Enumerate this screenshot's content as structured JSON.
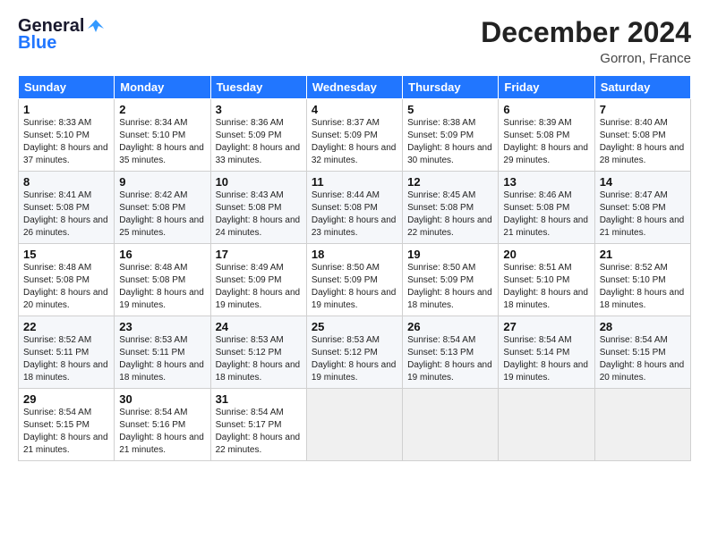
{
  "logo": {
    "general": "General",
    "blue": "Blue"
  },
  "header": {
    "month_year": "December 2024",
    "location": "Gorron, France"
  },
  "columns": [
    "Sunday",
    "Monday",
    "Tuesday",
    "Wednesday",
    "Thursday",
    "Friday",
    "Saturday"
  ],
  "weeks": [
    [
      {
        "day": "1",
        "sunrise": "Sunrise: 8:33 AM",
        "sunset": "Sunset: 5:10 PM",
        "daylight": "Daylight: 8 hours and 37 minutes."
      },
      {
        "day": "2",
        "sunrise": "Sunrise: 8:34 AM",
        "sunset": "Sunset: 5:10 PM",
        "daylight": "Daylight: 8 hours and 35 minutes."
      },
      {
        "day": "3",
        "sunrise": "Sunrise: 8:36 AM",
        "sunset": "Sunset: 5:09 PM",
        "daylight": "Daylight: 8 hours and 33 minutes."
      },
      {
        "day": "4",
        "sunrise": "Sunrise: 8:37 AM",
        "sunset": "Sunset: 5:09 PM",
        "daylight": "Daylight: 8 hours and 32 minutes."
      },
      {
        "day": "5",
        "sunrise": "Sunrise: 8:38 AM",
        "sunset": "Sunset: 5:09 PM",
        "daylight": "Daylight: 8 hours and 30 minutes."
      },
      {
        "day": "6",
        "sunrise": "Sunrise: 8:39 AM",
        "sunset": "Sunset: 5:08 PM",
        "daylight": "Daylight: 8 hours and 29 minutes."
      },
      {
        "day": "7",
        "sunrise": "Sunrise: 8:40 AM",
        "sunset": "Sunset: 5:08 PM",
        "daylight": "Daylight: 8 hours and 28 minutes."
      }
    ],
    [
      {
        "day": "8",
        "sunrise": "Sunrise: 8:41 AM",
        "sunset": "Sunset: 5:08 PM",
        "daylight": "Daylight: 8 hours and 26 minutes."
      },
      {
        "day": "9",
        "sunrise": "Sunrise: 8:42 AM",
        "sunset": "Sunset: 5:08 PM",
        "daylight": "Daylight: 8 hours and 25 minutes."
      },
      {
        "day": "10",
        "sunrise": "Sunrise: 8:43 AM",
        "sunset": "Sunset: 5:08 PM",
        "daylight": "Daylight: 8 hours and 24 minutes."
      },
      {
        "day": "11",
        "sunrise": "Sunrise: 8:44 AM",
        "sunset": "Sunset: 5:08 PM",
        "daylight": "Daylight: 8 hours and 23 minutes."
      },
      {
        "day": "12",
        "sunrise": "Sunrise: 8:45 AM",
        "sunset": "Sunset: 5:08 PM",
        "daylight": "Daylight: 8 hours and 22 minutes."
      },
      {
        "day": "13",
        "sunrise": "Sunrise: 8:46 AM",
        "sunset": "Sunset: 5:08 PM",
        "daylight": "Daylight: 8 hours and 21 minutes."
      },
      {
        "day": "14",
        "sunrise": "Sunrise: 8:47 AM",
        "sunset": "Sunset: 5:08 PM",
        "daylight": "Daylight: 8 hours and 21 minutes."
      }
    ],
    [
      {
        "day": "15",
        "sunrise": "Sunrise: 8:48 AM",
        "sunset": "Sunset: 5:08 PM",
        "daylight": "Daylight: 8 hours and 20 minutes."
      },
      {
        "day": "16",
        "sunrise": "Sunrise: 8:48 AM",
        "sunset": "Sunset: 5:08 PM",
        "daylight": "Daylight: 8 hours and 19 minutes."
      },
      {
        "day": "17",
        "sunrise": "Sunrise: 8:49 AM",
        "sunset": "Sunset: 5:09 PM",
        "daylight": "Daylight: 8 hours and 19 minutes."
      },
      {
        "day": "18",
        "sunrise": "Sunrise: 8:50 AM",
        "sunset": "Sunset: 5:09 PM",
        "daylight": "Daylight: 8 hours and 19 minutes."
      },
      {
        "day": "19",
        "sunrise": "Sunrise: 8:50 AM",
        "sunset": "Sunset: 5:09 PM",
        "daylight": "Daylight: 8 hours and 18 minutes."
      },
      {
        "day": "20",
        "sunrise": "Sunrise: 8:51 AM",
        "sunset": "Sunset: 5:10 PM",
        "daylight": "Daylight: 8 hours and 18 minutes."
      },
      {
        "day": "21",
        "sunrise": "Sunrise: 8:52 AM",
        "sunset": "Sunset: 5:10 PM",
        "daylight": "Daylight: 8 hours and 18 minutes."
      }
    ],
    [
      {
        "day": "22",
        "sunrise": "Sunrise: 8:52 AM",
        "sunset": "Sunset: 5:11 PM",
        "daylight": "Daylight: 8 hours and 18 minutes."
      },
      {
        "day": "23",
        "sunrise": "Sunrise: 8:53 AM",
        "sunset": "Sunset: 5:11 PM",
        "daylight": "Daylight: 8 hours and 18 minutes."
      },
      {
        "day": "24",
        "sunrise": "Sunrise: 8:53 AM",
        "sunset": "Sunset: 5:12 PM",
        "daylight": "Daylight: 8 hours and 18 minutes."
      },
      {
        "day": "25",
        "sunrise": "Sunrise: 8:53 AM",
        "sunset": "Sunset: 5:12 PM",
        "daylight": "Daylight: 8 hours and 19 minutes."
      },
      {
        "day": "26",
        "sunrise": "Sunrise: 8:54 AM",
        "sunset": "Sunset: 5:13 PM",
        "daylight": "Daylight: 8 hours and 19 minutes."
      },
      {
        "day": "27",
        "sunrise": "Sunrise: 8:54 AM",
        "sunset": "Sunset: 5:14 PM",
        "daylight": "Daylight: 8 hours and 19 minutes."
      },
      {
        "day": "28",
        "sunrise": "Sunrise: 8:54 AM",
        "sunset": "Sunset: 5:15 PM",
        "daylight": "Daylight: 8 hours and 20 minutes."
      }
    ],
    [
      {
        "day": "29",
        "sunrise": "Sunrise: 8:54 AM",
        "sunset": "Sunset: 5:15 PM",
        "daylight": "Daylight: 8 hours and 21 minutes."
      },
      {
        "day": "30",
        "sunrise": "Sunrise: 8:54 AM",
        "sunset": "Sunset: 5:16 PM",
        "daylight": "Daylight: 8 hours and 21 minutes."
      },
      {
        "day": "31",
        "sunrise": "Sunrise: 8:54 AM",
        "sunset": "Sunset: 5:17 PM",
        "daylight": "Daylight: 8 hours and 22 minutes."
      },
      null,
      null,
      null,
      null
    ]
  ]
}
